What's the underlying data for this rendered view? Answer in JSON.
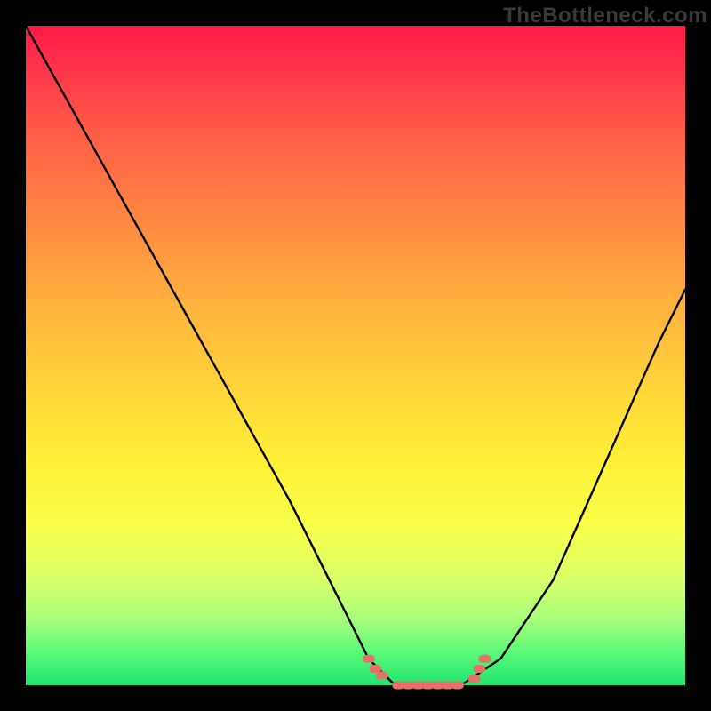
{
  "watermark": "TheBottleneck.com",
  "chart_data": {
    "type": "line",
    "title": "",
    "xlabel": "",
    "ylabel": "",
    "ylim": [
      0,
      100
    ],
    "series": [
      {
        "name": "curve",
        "x": [
          0,
          10,
          20,
          30,
          40,
          48,
          52,
          56,
          62,
          66,
          72,
          80,
          88,
          96,
          100
        ],
        "values": [
          100,
          82,
          64,
          46,
          28,
          12,
          4,
          0,
          0,
          0,
          4,
          16,
          34,
          52,
          60
        ]
      }
    ],
    "flat_segment": {
      "x_start": 54,
      "x_end": 68,
      "y": 0
    },
    "markers": [
      {
        "x": 52.0,
        "y": 4.0
      },
      {
        "x": 53.0,
        "y": 2.5
      },
      {
        "x": 54.0,
        "y": 1.5
      },
      {
        "x": 56.5,
        "y": 0.0
      },
      {
        "x": 58.0,
        "y": 0.0
      },
      {
        "x": 59.5,
        "y": 0.0
      },
      {
        "x": 61.0,
        "y": 0.0
      },
      {
        "x": 62.5,
        "y": 0.0
      },
      {
        "x": 64.0,
        "y": 0.0
      },
      {
        "x": 65.5,
        "y": 0.0
      },
      {
        "x": 68.0,
        "y": 1.0
      },
      {
        "x": 68.8,
        "y": 2.5
      },
      {
        "x": 69.6,
        "y": 4.0
      }
    ],
    "colors": {
      "curve_stroke": "#000000",
      "marker_fill": "#e6716b",
      "gradient_top": "#ff1948",
      "gradient_bottom": "#20e56e"
    }
  }
}
